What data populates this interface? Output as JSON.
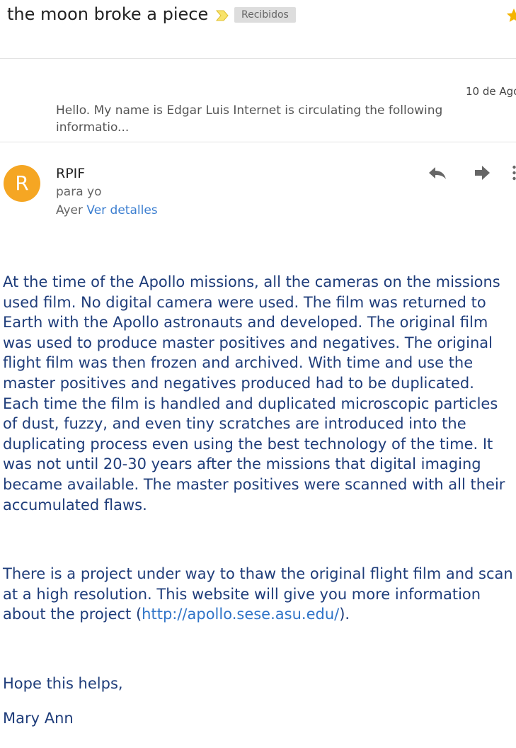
{
  "header": {
    "subject": "the moon broke a piece",
    "label": "Recibidos",
    "icons": {
      "important": "important-marker-icon",
      "star": "star-icon"
    },
    "colors": {
      "important": "#f8e36b",
      "star": "#f4b400",
      "label_bg": "#dddddd"
    }
  },
  "previous_message": {
    "date": "10 de Ago",
    "snippet": "Hello. My name is Edgar Luis Internet is circulating the following informatio..."
  },
  "message": {
    "avatar_letter": "R",
    "avatar_color": "#f5a623",
    "sender": "RPIF",
    "recipient": "para yo",
    "time": "Ayer",
    "details_link": "Ver detalles",
    "actions": {
      "reply": "reply-icon",
      "forward": "forward-icon",
      "more": "more-vert-icon"
    },
    "body": {
      "paragraph1": "At the time of the Apollo missions, all the cameras on the missions used film.  No digital camera were used.  The film was returned to Earth with the Apollo astronauts and developed.  The original film was used to produce master positives and negatives.  The original flight film was then frozen and archived.  With time and use the master positives and negatives produced had to be duplicated.  Each time the film is handled and duplicated microscopic particles of dust, fuzzy, and even tiny scratches are introduced into the duplicating process even using the best technology of the time.  It was not until 20-30  years after the missions that digital imaging became available.  The master positives were scanned with all their accumulated flaws.",
      "paragraph2_before": "There is a project under way to thaw the original flight film and scan at a high resolution.  This website will give you more information about the project (",
      "paragraph2_link": "http://apollo.sese.asu.edu/",
      "paragraph2_after": ").",
      "closing": "Hope this helps,",
      "signature": "Mary Ann"
    },
    "colors": {
      "body_text": "#1f3d7a",
      "link": "#2f74c8"
    }
  }
}
